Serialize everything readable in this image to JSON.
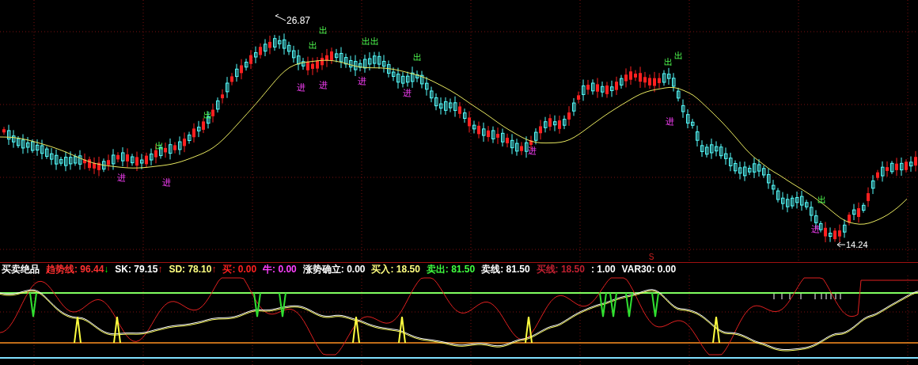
{
  "price_chart": {
    "high_label": "26.87",
    "low_label": "14.24",
    "marker": "S",
    "signals": [
      {
        "kind": "buy",
        "text": "进"
      },
      {
        "kind": "sell",
        "text": "出"
      },
      {
        "kind": "buy",
        "text": "进"
      },
      {
        "kind": "sell",
        "text": "出"
      },
      {
        "kind": "buy",
        "text": "进"
      },
      {
        "kind": "sell",
        "text": "出"
      },
      {
        "kind": "sell",
        "text": "出"
      },
      {
        "kind": "buy",
        "text": "进"
      },
      {
        "kind": "buy",
        "text": "进"
      },
      {
        "kind": "sell",
        "text": "出出"
      },
      {
        "kind": "buy",
        "text": "进"
      },
      {
        "kind": "sell",
        "text": "出"
      },
      {
        "kind": "buy",
        "text": "进"
      },
      {
        "kind": "sell",
        "text": "出"
      },
      {
        "kind": "buy",
        "text": "进"
      },
      {
        "kind": "sell",
        "text": "出"
      },
      {
        "kind": "buy",
        "text": "进"
      },
      {
        "kind": "sell",
        "text": "出"
      }
    ]
  },
  "indicator": {
    "title": "买卖绝品",
    "readings": [
      {
        "label": "趋势线:",
        "value": "96.44",
        "color": "#ff3030",
        "arrow": "↓",
        "rising": false
      },
      {
        "label": "SK:",
        "value": "79.15",
        "color": "#ffffff",
        "arrow": "↑",
        "rising": true
      },
      {
        "label": "SD:",
        "value": "78.10",
        "color": "#ffff80",
        "arrow": "↑",
        "rising": true
      },
      {
        "label": "买:",
        "value": "0.00",
        "color": "#ff2020"
      },
      {
        "label": "牛:",
        "value": "0.00",
        "color": "#ff40ff"
      },
      {
        "label": "涨势确立:",
        "value": "0.00",
        "color": "#ffffff"
      },
      {
        "label": "买入:",
        "value": "18.50",
        "color": "#ffff80"
      },
      {
        "label": "卖出:",
        "value": "81.50",
        "color": "#40ff40"
      },
      {
        "label": "卖线:",
        "value": "81.50",
        "color": "#ffffff"
      },
      {
        "label": "买线:",
        "value": "18.50",
        "color": "#c02030"
      },
      {
        "label": ":",
        "value": "1.00",
        "color": "#ffffff"
      },
      {
        "label": "VAR30:",
        "value": "0.00",
        "color": "#ffffff"
      }
    ]
  }
}
